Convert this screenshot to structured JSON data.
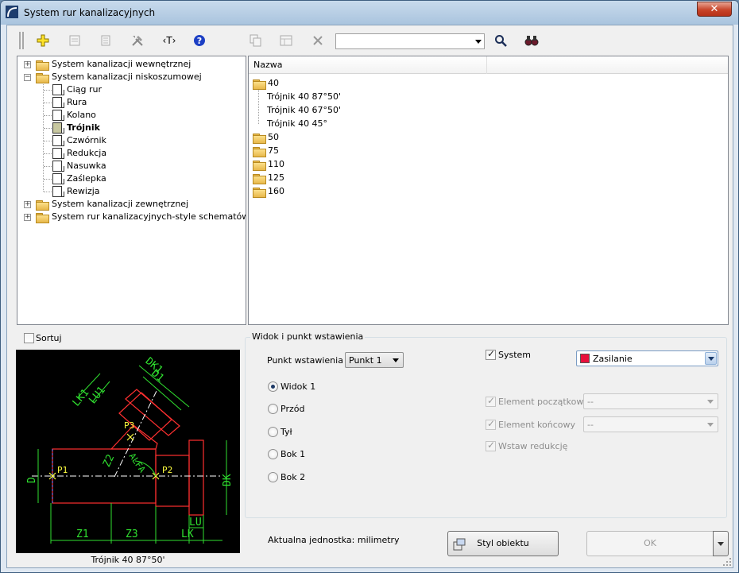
{
  "window": {
    "title": "System rur kanalizacyjnych",
    "close_label": "✕"
  },
  "toolbar": {
    "search_value": ""
  },
  "tree": [
    {
      "label": "System kanalizacji  wewnętrznej",
      "level": 0,
      "expander": "+"
    },
    {
      "label": "System kanalizacji niskoszumowej",
      "level": 0,
      "expander": "−"
    },
    {
      "label": "Ciąg rur",
      "level": 1
    },
    {
      "label": "Rura",
      "level": 1
    },
    {
      "label": "Kolano",
      "level": 1
    },
    {
      "label": "Trójnik",
      "level": 1,
      "selected": true
    },
    {
      "label": "Czwórnik",
      "level": 1
    },
    {
      "label": "Redukcja",
      "level": 1
    },
    {
      "label": "Nasuwka",
      "level": 1
    },
    {
      "label": "Zaślepka",
      "level": 1
    },
    {
      "label": "Rewizja",
      "level": 1
    },
    {
      "label": "System kanalizacji  zewnętrznej",
      "level": 0,
      "expander": "+"
    },
    {
      "label": "System rur kanalizacyjnych-style schematów",
      "level": 0,
      "expander": "+"
    }
  ],
  "list": {
    "column_header": "Nazwa",
    "rows": [
      {
        "label": "40",
        "type": "folder-open"
      },
      {
        "label": "Trójnik 40 87°50'",
        "type": "item"
      },
      {
        "label": "Trójnik 40 67°50'",
        "type": "item"
      },
      {
        "label": "Trójnik 40 45°",
        "type": "item"
      },
      {
        "label": "50",
        "type": "folder"
      },
      {
        "label": "75",
        "type": "folder"
      },
      {
        "label": "110",
        "type": "folder"
      },
      {
        "label": "125",
        "type": "folder"
      },
      {
        "label": "160",
        "type": "folder"
      }
    ]
  },
  "sort": {
    "label": "Sortuj",
    "checked": false
  },
  "preview": {
    "caption": "Trójnik 40 87°50'",
    "labels": {
      "p1": "P1",
      "p2": "P2",
      "p3": "P3",
      "d": "D",
      "dk": "DK",
      "dk1": "DK1",
      "d1": "D1",
      "lk1": "LK1",
      "lu1": "LU1",
      "z1": "Z1",
      "z2": "Z2",
      "z3": "Z3",
      "lu": "LU",
      "lk": "LK",
      "alfa": "ALFA"
    }
  },
  "group": {
    "title": "Widok i punkt wstawienia",
    "insert_point_label": "Punkt wstawienia",
    "insert_point_value": "Punkt 1",
    "views": [
      "Widok 1",
      "Przód",
      "Tył",
      "Bok 1",
      "Bok 2"
    ],
    "selected_view": 0,
    "system_label": "System",
    "system_checked": true,
    "system_value": "Zasilanie",
    "system_color": "#e8103c",
    "start_element_label": "Element początkowy",
    "start_element_value": "--",
    "end_element_label": "Element końcowy",
    "end_element_value": "--",
    "insert_reduction_label": "Wstaw redukcję"
  },
  "footer": {
    "units_text": "Aktualna jednostka: milimetry",
    "style_button": "Styl obiektu",
    "ok_button": "OK"
  }
}
